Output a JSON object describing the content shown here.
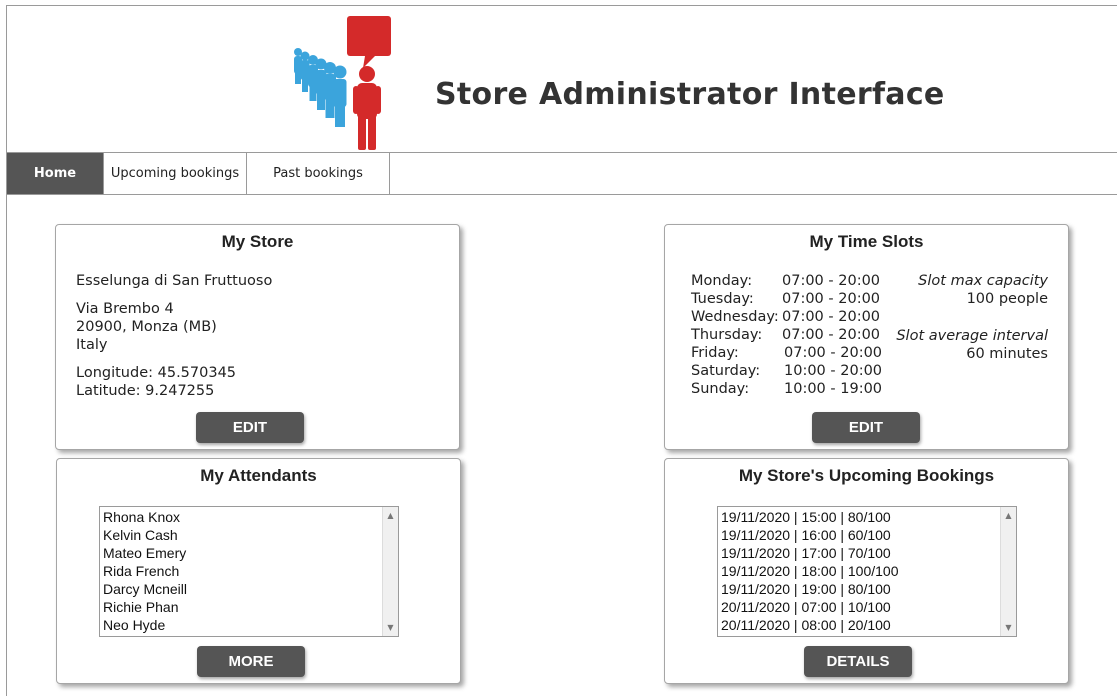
{
  "header": {
    "title": "Store Administrator Interface",
    "logo_icon": "queue-people-speech-bubble-logo"
  },
  "nav": {
    "tabs": [
      {
        "label": "Home",
        "active": true
      },
      {
        "label": "Upcoming bookings",
        "active": false
      },
      {
        "label": "Past bookings",
        "active": false
      }
    ]
  },
  "store": {
    "title": "My Store",
    "name": "Esselunga di San Fruttuoso",
    "address_line1": "Via Brembo 4",
    "address_line2": "20900, Monza (MB)",
    "address_line3": "Italy",
    "longitude": "Longitude: 45.570345",
    "latitude": "Latitude: 9.247255",
    "edit_label": "EDIT"
  },
  "slots": {
    "title": "My Time Slots",
    "days": [
      {
        "day": "Monday:",
        "hours": "07:00 - 20:00"
      },
      {
        "day": "Tuesday:",
        "hours": "07:00 - 20:00"
      },
      {
        "day": "Wednesday:",
        "hours": "07:00 - 20:00"
      },
      {
        "day": "Thursday:",
        "hours": "07:00 - 20:00"
      },
      {
        "day": "Friday:",
        "hours": "07:00 - 20:00"
      },
      {
        "day": "Saturday:",
        "hours": "10:00 - 20:00"
      },
      {
        "day": "Sunday:",
        "hours": "10:00 - 19:00"
      }
    ],
    "capacity_label": "Slot max capacity",
    "capacity_value": "100 people",
    "interval_label": "Slot average interval",
    "interval_value": "60 minutes",
    "edit_label": "EDIT"
  },
  "attendants": {
    "title": "My Attendants",
    "items": [
      "Rhona Knox",
      "Kelvin Cash",
      "Mateo Emery",
      "Rida French",
      "Darcy Mcneill",
      "Richie Phan",
      "Neo Hyde"
    ],
    "more_label": "MORE"
  },
  "bookings": {
    "title": "My Store's Upcoming Bookings",
    "items": [
      "19/11/2020 | 15:00 | 80/100",
      "19/11/2020 | 16:00 | 60/100",
      "19/11/2020 | 17:00 | 70/100",
      "19/11/2020 | 18:00 | 100/100",
      "19/11/2020 | 19:00 | 80/100",
      "20/11/2020 | 07:00 | 10/100",
      "20/11/2020 | 08:00 | 20/100"
    ],
    "details_label": "DETAILS"
  },
  "colors": {
    "nav_active": "#555555",
    "button": "#555555",
    "logo_red": "#d42a2a",
    "logo_blue": "#3ba4dc"
  }
}
